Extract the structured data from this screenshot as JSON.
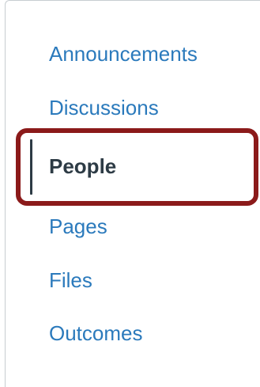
{
  "course_nav": {
    "items": [
      {
        "label": "Announcements",
        "active": false
      },
      {
        "label": "Discussions",
        "active": false
      },
      {
        "label": "People",
        "active": true
      },
      {
        "label": "Pages",
        "active": false
      },
      {
        "label": "Files",
        "active": false
      },
      {
        "label": "Outcomes",
        "active": false
      }
    ]
  },
  "colors": {
    "link": "#2b7abc",
    "active_text": "#2d3b45",
    "highlight_border": "#8b1a1a",
    "panel_border": "#c7cdd1"
  }
}
